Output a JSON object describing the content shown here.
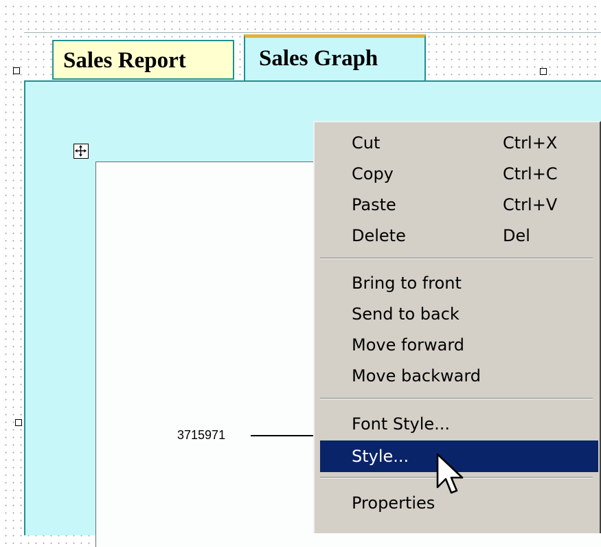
{
  "tabs": [
    {
      "label": "Sales Report",
      "active": false
    },
    {
      "label": "Sales Graph",
      "active": true
    }
  ],
  "chart": {
    "value_label": "3715971"
  },
  "context_menu": {
    "groups": [
      [
        {
          "label": "Cut",
          "shortcut": "Ctrl+X"
        },
        {
          "label": "Copy",
          "shortcut": "Ctrl+C"
        },
        {
          "label": "Paste",
          "shortcut": "Ctrl+V"
        },
        {
          "label": "Delete",
          "shortcut": "Del"
        }
      ],
      [
        {
          "label": "Bring to front"
        },
        {
          "label": "Send to back"
        },
        {
          "label": "Move forward"
        },
        {
          "label": "Move backward"
        }
      ],
      [
        {
          "label": "Font Style..."
        },
        {
          "label": "Style...",
          "selected": true
        }
      ],
      [
        {
          "label": "Properties"
        }
      ]
    ]
  },
  "colors": {
    "canvas_background": "#ffffff",
    "tab_report_background": "#ffffcf",
    "tab_graph_background": "#c8f7fa",
    "tab_graph_accent": "#e0b23b",
    "menu_background": "#d4d0c8",
    "menu_highlight": "#0a246a"
  },
  "icons": {
    "move_handle": "move-arrows-icon",
    "cursor": "arrow-cursor-icon"
  }
}
